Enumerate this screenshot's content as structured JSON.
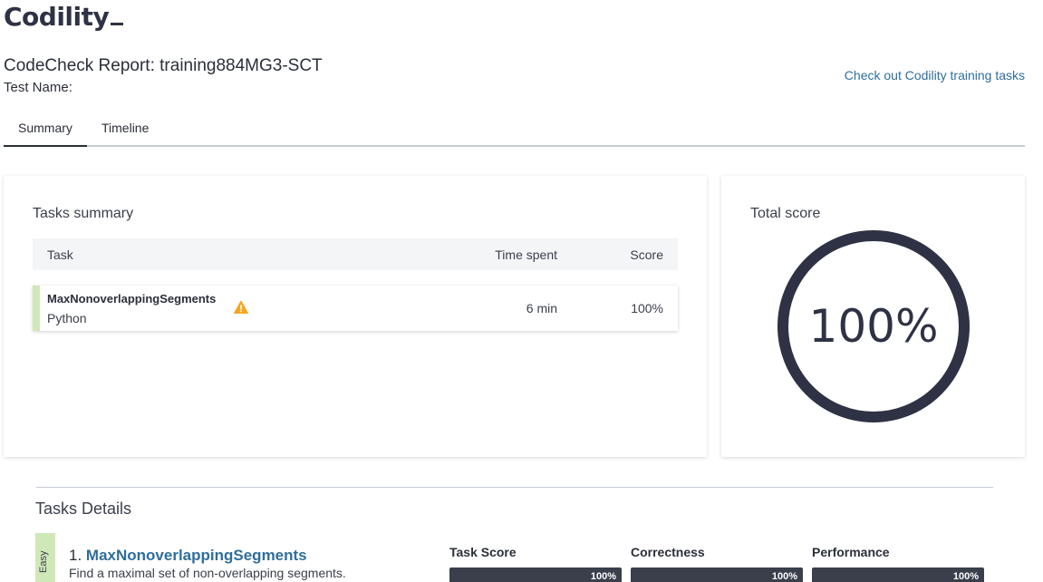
{
  "brand": {
    "logo_text": "Codility"
  },
  "header": {
    "report_title": "CodeCheck Report: training884MG3-SCT",
    "test_name_label": "Test Name:",
    "training_link": "Check out Codility training tasks"
  },
  "tabs": [
    {
      "label": "Summary",
      "active": true
    },
    {
      "label": "Timeline",
      "active": false
    }
  ],
  "tasks_summary": {
    "title": "Tasks summary",
    "columns": {
      "task": "Task",
      "time_spent": "Time spent",
      "score": "Score"
    },
    "rows": [
      {
        "name": "MaxNonoverlappingSegments",
        "language": "Python",
        "time": "6 min",
        "score": "100%",
        "warning": true
      }
    ]
  },
  "total_score": {
    "title": "Total score",
    "value": "100%",
    "fraction": 1.0
  },
  "tasks_details": {
    "title": "Tasks Details",
    "items": [
      {
        "difficulty": "Easy",
        "index": "1.",
        "name": "MaxNonoverlappingSegments",
        "description": "Find a maximal set of non-overlapping segments.",
        "metrics": [
          {
            "label": "Task Score",
            "value": "100%"
          },
          {
            "label": "Correctness",
            "value": "100%"
          },
          {
            "label": "Performance",
            "value": "100%"
          }
        ]
      }
    ]
  },
  "colors": {
    "accent_dark": "#2e3244",
    "link": "#2f6e9c",
    "easy_green": "#cfe8b8",
    "warning": "#f5a623"
  }
}
